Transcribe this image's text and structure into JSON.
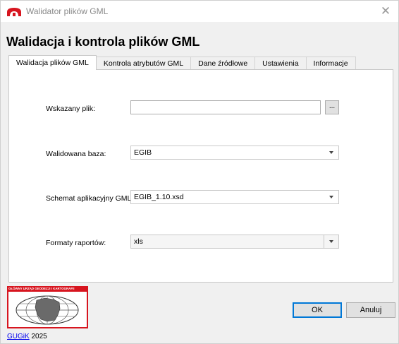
{
  "window": {
    "title": "Walidator plików GML",
    "close_glyph": "✕"
  },
  "heading": "Walidacja i kontrola plików GML",
  "tabs": [
    {
      "label": "Walidacja plików GML",
      "active": true
    },
    {
      "label": "Kontrola atrybutów GML",
      "active": false
    },
    {
      "label": "Dane źródłowe",
      "active": false
    },
    {
      "label": "Ustawienia",
      "active": false
    },
    {
      "label": "Informacje",
      "active": false
    }
  ],
  "form": {
    "file_label": "Wskazany plik:",
    "file_value": "",
    "browse_label": "...",
    "base_label": "Walidowana baza:",
    "base_value": "EGIB",
    "schema_label": "Schemat aplikacyjny GML:",
    "schema_value": "EGIB_1.10.xsd",
    "format_label": "Formaty raportów:",
    "format_value": "xls"
  },
  "logo": {
    "caption": "GŁÓWNY URZĄD GEODEZJI I KARTOGRAFII",
    "brand_color": "#d7151f"
  },
  "buttons": {
    "ok": "OK",
    "cancel": "Anuluj"
  },
  "footer": {
    "link": "GUGiK",
    "year": "2025"
  },
  "colors": {
    "accent": "#0078d7",
    "link": "#0000ee"
  }
}
